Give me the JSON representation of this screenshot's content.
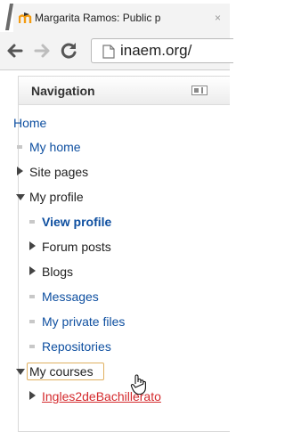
{
  "browser": {
    "tab_title": "Margarita Ramos: Public p",
    "tab_close": "×",
    "url": "inaem.org/"
  },
  "navigation": {
    "title": "Navigation",
    "home": "Home",
    "my_home": "My home",
    "site_pages": "Site pages",
    "my_profile": {
      "label": "My profile",
      "children": {
        "view_profile": "View profile",
        "forum_posts": "Forum posts",
        "blogs": "Blogs",
        "messages": "Messages",
        "my_private_files": "My private files",
        "repositories": "Repositories"
      }
    },
    "my_courses": {
      "label": "My courses",
      "course": "Ingles2deBachillerato"
    }
  },
  "colors": {
    "link": "#0e4fa0",
    "active_course": "#d4292c",
    "focus_border": "#e0b060"
  }
}
